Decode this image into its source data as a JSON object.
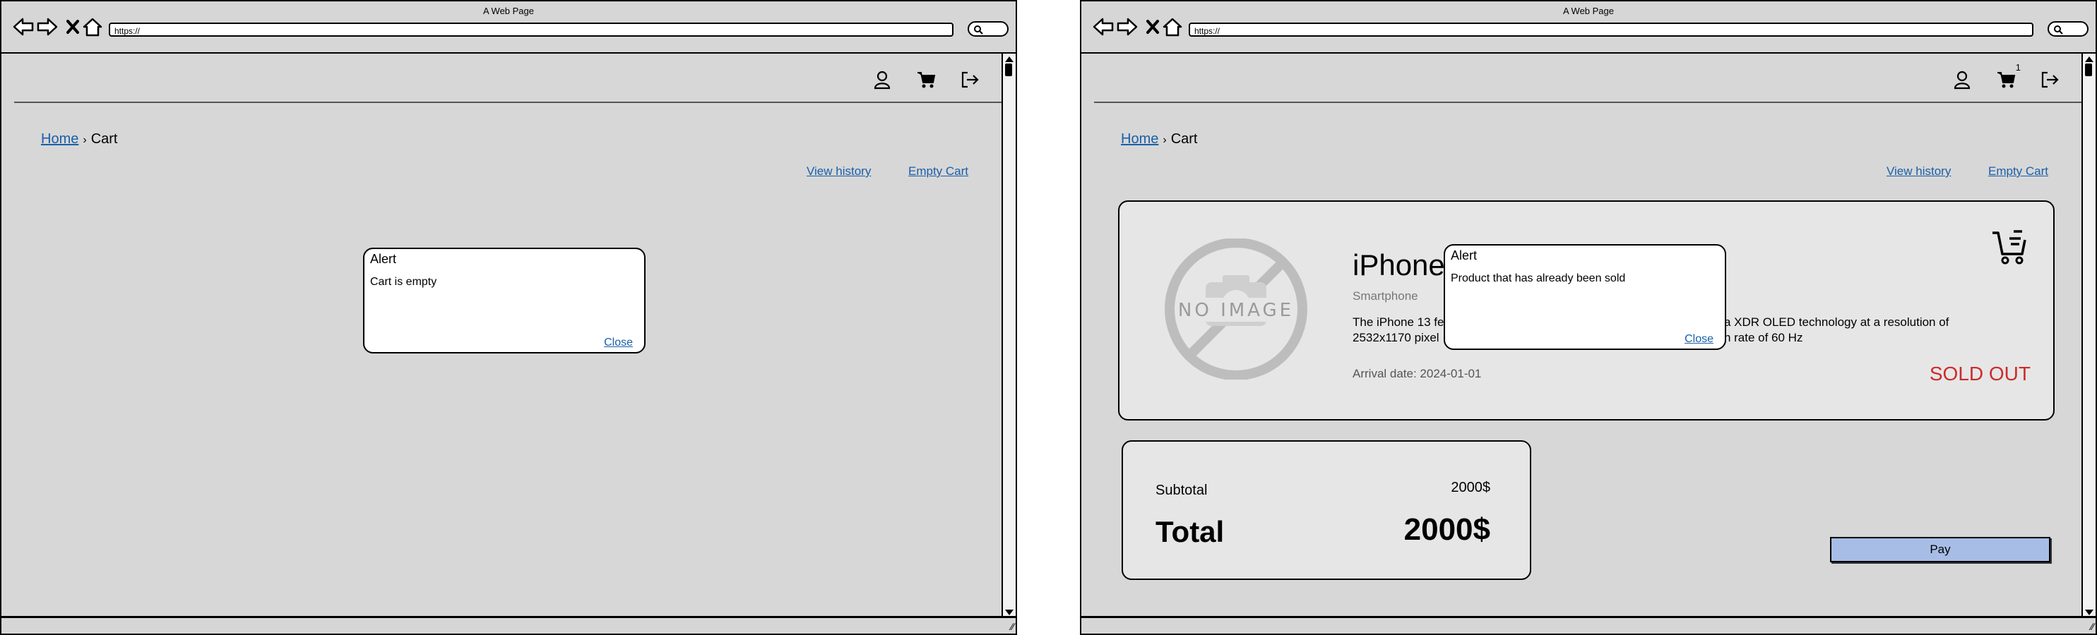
{
  "browser": {
    "title": "A Web Page",
    "url": "https://"
  },
  "left_page": {
    "breadcrumb": {
      "home": "Home",
      "separator": "›",
      "current": "Cart"
    },
    "links": {
      "view_history": "View history",
      "empty_cart": "Empty Cart"
    },
    "alert": {
      "title": "Alert",
      "message": "Cart is empty",
      "close": "Close"
    }
  },
  "right_page": {
    "cart_badge": "1",
    "breadcrumb": {
      "home": "Home",
      "separator": "›",
      "current": "Cart"
    },
    "links": {
      "view_history": "View history",
      "empty_cart": "Empty Cart"
    },
    "product": {
      "image_placeholder": "NO IMAGE",
      "name": "iPhone",
      "category": "Smartphone",
      "description_line1": "The iPhone 13 fe",
      "description_line1_end": "tina XDR OLED technology at a resolution of",
      "description_line2": "2532x1170 pixel",
      "description_line2_end": "esh rate of 60 Hz",
      "arrival": "Arrival date: 2024-01-01",
      "status": "SOLD OUT"
    },
    "alert": {
      "title": "Alert",
      "message": "Product that has already been sold",
      "close": "Close"
    },
    "totals": {
      "subtotal_label": "Subtotal",
      "subtotal_value": "2000$",
      "total_label": "Total",
      "total_value": "2000$"
    },
    "pay_label": "Pay"
  },
  "colors": {
    "link": "#1a5fa8",
    "sold_out": "#cc2b2b",
    "pay_button": "#a7bde6",
    "page_bg": "#d7d7d7"
  },
  "icons": [
    "back-arrow-icon",
    "forward-arrow-icon",
    "close-x-icon",
    "home-icon",
    "search-icon",
    "user-icon",
    "cart-icon",
    "logout-icon",
    "no-image-icon",
    "add-to-cart-icon"
  ]
}
